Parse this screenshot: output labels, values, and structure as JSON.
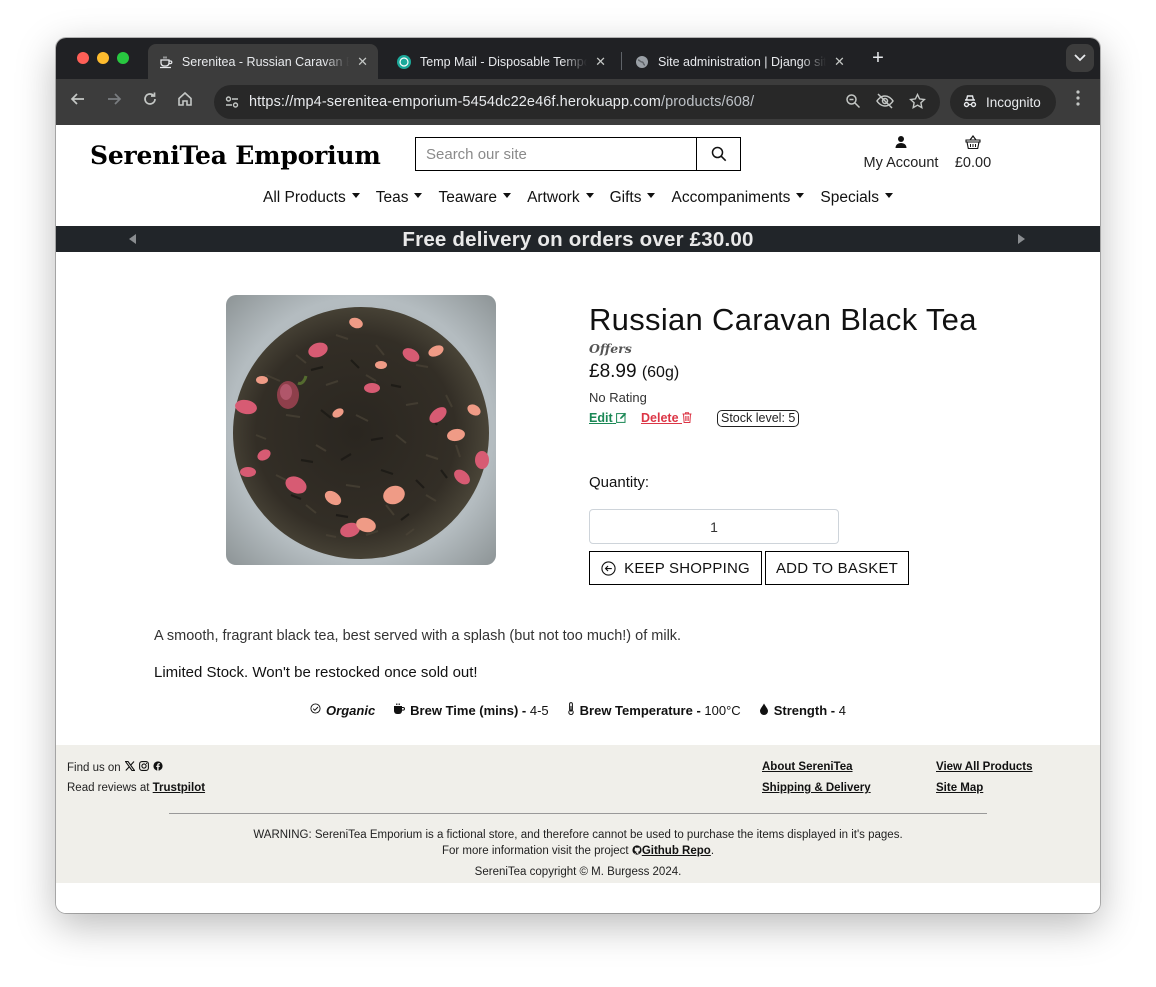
{
  "browser": {
    "tabs": [
      {
        "title": "Serenitea - Russian Caravan Black Tea",
        "active": true,
        "icon": "teacup-icon"
      },
      {
        "title": "Temp Mail - Disposable Temporary Email",
        "active": false,
        "icon": "tempmail-icon"
      },
      {
        "title": "Site administration | Django site admin",
        "active": false,
        "icon": "globe-icon"
      }
    ],
    "url_host": "https://mp4-serenitea-emporium-5454dc22e46f.herokuapp.com",
    "url_path": "/products/608/",
    "incognito_label": "Incognito"
  },
  "header": {
    "brand": "SereniTea Emporium",
    "search_placeholder": "Search our site",
    "account_label": "My Account",
    "basket_total": "£0.00"
  },
  "nav": {
    "items": [
      "All Products",
      "Teas",
      "Teaware",
      "Artwork",
      "Gifts",
      "Accompaniments",
      "Specials"
    ]
  },
  "banner": {
    "text": "Free delivery on orders over £30.00"
  },
  "product": {
    "name": "Russian Caravan Black Tea",
    "category": "Offers",
    "price": "£8.99",
    "weight": "(60g)",
    "rating": "No Rating",
    "edit_label": "Edit",
    "delete_label": "Delete",
    "stock": "Stock level: 5",
    "quantity_label": "Quantity:",
    "quantity_value": "1",
    "keep_shopping_label": "KEEP SHOPPING",
    "add_to_basket_label": "ADD TO BASKET",
    "description": "A smooth, fragrant black tea, best served with a splash (but not too much!) of milk.",
    "stock_note": "Limited Stock. Won't be restocked once sold out!",
    "attributes": {
      "organic": "Organic",
      "brew_time_label": "Brew Time (mins) -",
      "brew_time_value": "4-5",
      "brew_temp_label": "Brew Temperature -",
      "brew_temp_value": "100°C",
      "strength_label": "Strength -",
      "strength_value": "4"
    }
  },
  "footer": {
    "find_us": "Find us on",
    "reviews_prefix": "Read reviews at",
    "trustpilot": "Trustpilot",
    "about": "About SereniTea",
    "shipping": "Shipping & Delivery",
    "view_all": "View All Products",
    "site_map": "Site Map",
    "warning": "WARNING: SereniTea Emporium is a fictional store, and therefore cannot be used to purchase the items displayed in it's pages.",
    "more_info_prefix": "For more information visit the project",
    "github": "Github Repo",
    "copyright": "SereniTea copyright © M. Burgess 2024."
  }
}
